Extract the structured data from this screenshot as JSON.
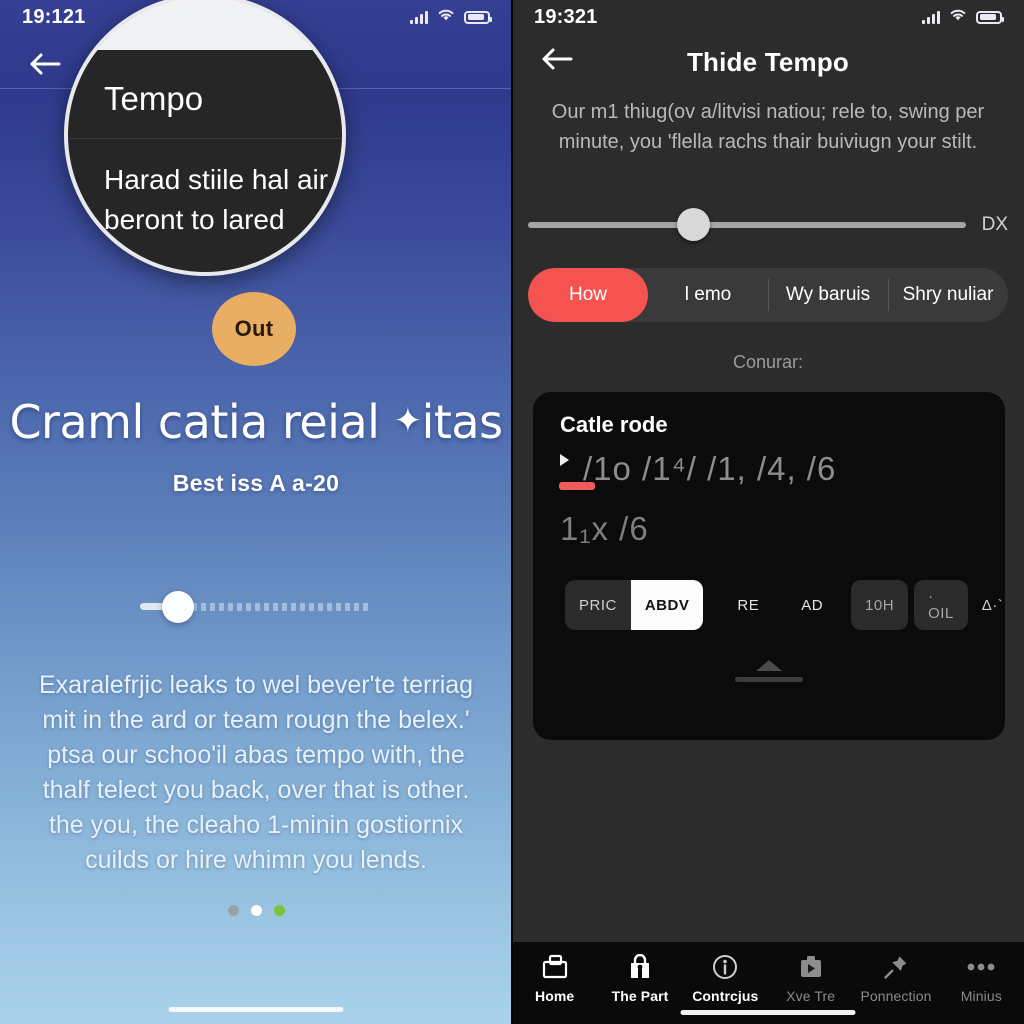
{
  "left": {
    "status": {
      "time": "19:121",
      "signal_icon": "signal-bars-icon",
      "wifi_icon": "wifi-icon",
      "battery_icon": "battery-icon"
    },
    "back_icon": "back-arrow-icon",
    "loupe": {
      "heading": "Tempo",
      "body": "Harad stiile hal air beront to lared"
    },
    "badge": {
      "label": "Out"
    },
    "title": "Craml catia reial",
    "title_sparkle": "✦",
    "title_tail": "itas",
    "subtitle": "Best iss A a-20",
    "slider": {
      "name": "tempo-slider",
      "value_pct": 17
    },
    "body_text": "Exaralefrjic leaks to wel bever'te terriag mit in the ard or team rougn the belex.' ptsa our schoo'il abas tempo with, the thalf telect you back, over that is other. the you, the cleaho 1-minin gostiornix cuilds or hire whimn you lends.",
    "page_dots": [
      {
        "name": "page-dot-1",
        "color": "#9aa2aa",
        "active": false
      },
      {
        "name": "page-dot-2",
        "color": "#ffffff",
        "active": true
      },
      {
        "name": "page-dot-3",
        "color": "#7ac43a",
        "active": false
      }
    ]
  },
  "right": {
    "status": {
      "time": "19:321",
      "signal_icon": "signal-bars-icon",
      "wifi_icon": "wifi-icon",
      "battery_icon": "battery-icon"
    },
    "back_icon": "back-arrow-icon",
    "title": "Thide Tempo",
    "description": "Our m1 thiug(ov a/litvisi natiou; rele to, swing per minute, you 'flella rachs thair buiviugn your stilt.",
    "slider": {
      "name": "tempo-slider",
      "value_pct": 34,
      "right_label": "DX"
    },
    "segments": [
      {
        "label": "How",
        "active": true
      },
      {
        "label": "l emo",
        "active": false
      },
      {
        "label": "Wy baruis",
        "active": false
      },
      {
        "label": "Shry nuliar",
        "active": false
      }
    ],
    "sublabel": "Conurar:",
    "card": {
      "title": "Catle rode",
      "line1": "/1o /1⁴/ /1, /4, /6",
      "line2": "1₁x /6",
      "chips": [
        {
          "label": "PRIC",
          "style": "g"
        },
        {
          "label": "ABDV",
          "style": "w"
        },
        {
          "label": "RE",
          "style": "plain"
        },
        {
          "label": "AD",
          "style": "plain"
        },
        {
          "label": "10H",
          "style": "sq"
        },
        {
          "label": "· OIL",
          "style": "sq"
        },
        {
          "label": "Δ·`",
          "style": "tri"
        },
        {
          "label": "|",
          "style": "bar"
        }
      ],
      "collapse_icon": "chevron-up-icon"
    },
    "tabs": [
      {
        "label": "Home",
        "icon": "inbox-tray-icon",
        "active": true
      },
      {
        "label": "The Part",
        "icon": "lock-bag-icon",
        "active": true
      },
      {
        "label": "Contrcjus",
        "icon": "info-circle-icon",
        "active": true
      },
      {
        "label": "Xve Tre",
        "icon": "media-briefcase-icon",
        "active": false
      },
      {
        "label": "Ponnection",
        "icon": "pin-icon",
        "active": false
      },
      {
        "label": "Minius",
        "icon": "ellipsis-icon",
        "active": false
      }
    ]
  },
  "colors": {
    "accent_red": "#f4534f",
    "badge_orange": "#e8ae63",
    "card_bg": "#0b0b0b",
    "panel_dark": "#2c2c2c"
  }
}
